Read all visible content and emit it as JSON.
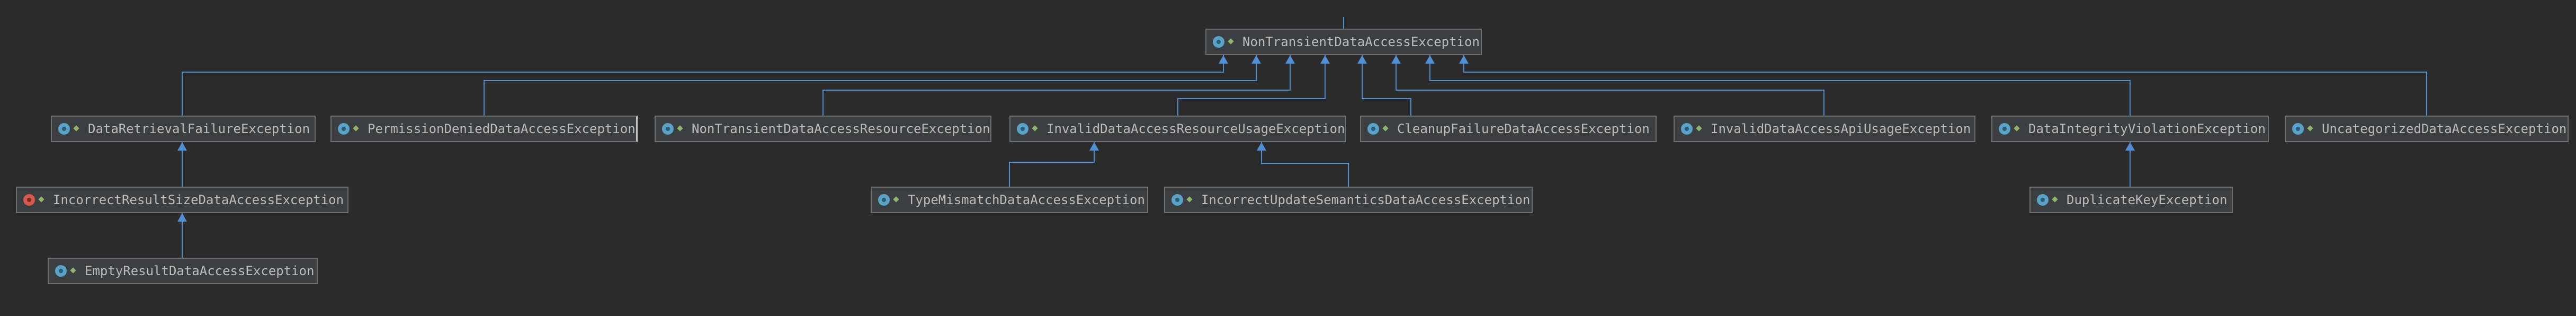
{
  "colors": {
    "background": "#2b2b2b",
    "node_fill": "#3c3f41",
    "node_border": "#6e6e6e",
    "text": "#bbbbbb",
    "edge": "#4e8fd8",
    "class_icon": "#5aa3c8",
    "exception_icon": "#d9594f",
    "access_icon": "#8fb46c"
  },
  "nodes": {
    "root": {
      "label": "NonTransientDataAccessException",
      "icon": "class-icon"
    },
    "data_retrieval": {
      "label": "DataRetrievalFailureException",
      "icon": "class-icon"
    },
    "permission_denied": {
      "label": "PermissionDeniedDataAccessException",
      "icon": "class-icon"
    },
    "resource": {
      "label": "NonTransientDataAccessResourceException",
      "icon": "class-icon"
    },
    "invalid_resource_usage": {
      "label": "InvalidDataAccessResourceUsageException",
      "icon": "class-icon"
    },
    "cleanup_failure": {
      "label": "CleanupFailureDataAccessException",
      "icon": "class-icon"
    },
    "invalid_api_usage": {
      "label": "InvalidDataAccessApiUsageException",
      "icon": "class-icon"
    },
    "integrity_violation": {
      "label": "DataIntegrityViolationException",
      "icon": "class-icon"
    },
    "uncategorized": {
      "label": "UncategorizedDataAccessException",
      "icon": "class-icon"
    },
    "incorrect_result_size": {
      "label": "IncorrectResultSizeDataAccessException",
      "icon": "exception-icon"
    },
    "empty_result": {
      "label": "EmptyResultDataAccessException",
      "icon": "class-icon"
    },
    "type_mismatch": {
      "label": "TypeMismatchDataAccessException",
      "icon": "class-icon"
    },
    "incorrect_update": {
      "label": "IncorrectUpdateSemanticsDataAccessException",
      "icon": "class-icon"
    },
    "duplicate_key": {
      "label": "DuplicateKeyException",
      "icon": "class-icon"
    }
  },
  "edges": [
    {
      "from": "data_retrieval",
      "to": "root"
    },
    {
      "from": "permission_denied",
      "to": "root"
    },
    {
      "from": "resource",
      "to": "root"
    },
    {
      "from": "invalid_resource_usage",
      "to": "root"
    },
    {
      "from": "cleanup_failure",
      "to": "root"
    },
    {
      "from": "invalid_api_usage",
      "to": "root"
    },
    {
      "from": "integrity_violation",
      "to": "root"
    },
    {
      "from": "uncategorized",
      "to": "root"
    },
    {
      "from": "incorrect_result_size",
      "to": "data_retrieval"
    },
    {
      "from": "empty_result",
      "to": "incorrect_result_size"
    },
    {
      "from": "type_mismatch",
      "to": "invalid_resource_usage"
    },
    {
      "from": "incorrect_update",
      "to": "invalid_resource_usage"
    },
    {
      "from": "duplicate_key",
      "to": "integrity_violation"
    }
  ]
}
